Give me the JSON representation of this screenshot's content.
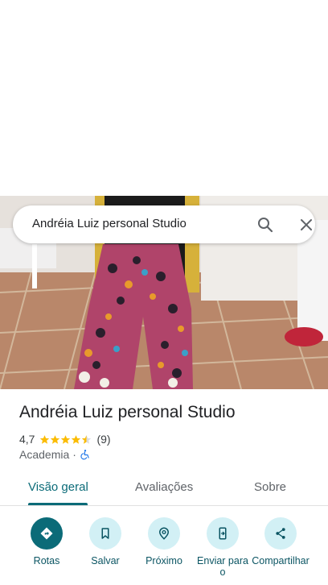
{
  "search": {
    "query": "Andréia Luiz personal Studio"
  },
  "place": {
    "name": "Andréia Luiz personal Studio",
    "rating": "4,7",
    "rating_stars": 4.5,
    "review_count": "(9)",
    "category": "Academia",
    "separator": "·"
  },
  "tabs": [
    {
      "label": "Visão geral",
      "active": true
    },
    {
      "label": "Avaliações",
      "active": false
    },
    {
      "label": "Sobre",
      "active": false
    }
  ],
  "actions": [
    {
      "label": "Rotas",
      "icon": "directions-icon"
    },
    {
      "label": "Salvar",
      "icon": "bookmark-icon"
    },
    {
      "label": "Próximo",
      "icon": "nearby-icon"
    },
    {
      "label": "Enviar para o",
      "icon": "send-to-phone-icon"
    },
    {
      "label": "Compartilhar",
      "icon": "share-icon"
    }
  ],
  "colors": {
    "accent": "#0b6b78",
    "accent_light": "#d2f0f5",
    "star": "#fbbc04"
  }
}
